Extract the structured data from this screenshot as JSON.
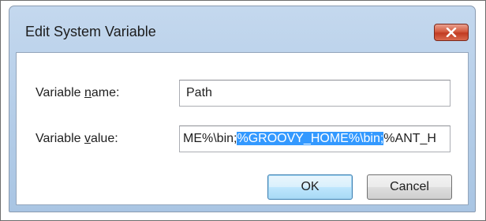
{
  "window": {
    "title": "Edit System Variable",
    "close_icon": "close-icon"
  },
  "fields": {
    "name": {
      "label_pre": "Variable ",
      "label_access": "n",
      "label_post": "ame:",
      "value": "Path"
    },
    "value": {
      "label_pre": "Variable ",
      "label_access": "v",
      "label_post": "alue:",
      "value_before": "ME%\\bin;",
      "value_selected": "%GROOVY_HOME%\\bin;",
      "value_after": "%ANT_H"
    }
  },
  "buttons": {
    "ok": "OK",
    "cancel": "Cancel"
  },
  "colors": {
    "selection": "#3399ff",
    "close_button": "#c23b22"
  }
}
